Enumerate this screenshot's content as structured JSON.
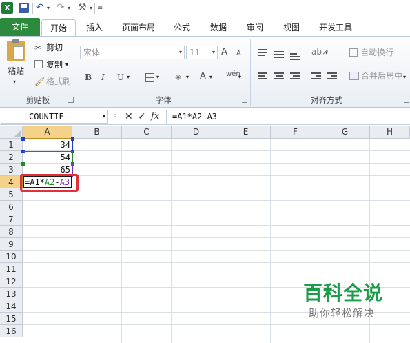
{
  "quick_access": {
    "logo": "X",
    "icons": [
      "excel-logo-icon",
      "save-icon",
      "undo-icon",
      "redo-icon",
      "tools-icon",
      "customize-icon"
    ]
  },
  "tabs": [
    {
      "label": "文件"
    },
    {
      "label": "开始"
    },
    {
      "label": "插入"
    },
    {
      "label": "页面布局"
    },
    {
      "label": "公式"
    },
    {
      "label": "数据"
    },
    {
      "label": "审阅"
    },
    {
      "label": "视图"
    },
    {
      "label": "开发工具"
    }
  ],
  "ribbon": {
    "clipboard": {
      "paste": "粘贴",
      "cut": "剪切",
      "copy": "复制",
      "format_painter": "格式刷",
      "group": "剪贴板"
    },
    "font": {
      "name": "宋体",
      "size": "11",
      "bold": "B",
      "italic": "I",
      "underline": "U",
      "grow": "A",
      "shrink": "A",
      "group": "字体"
    },
    "alignment": {
      "wrap": "自动换行",
      "merge": "合并后居中",
      "group": "对齐方式"
    },
    "accent": "#2b8a3e"
  },
  "formula_bar": {
    "name_box": "COUNTIF",
    "cancel": "✕",
    "enter": "✓",
    "fx": "fx",
    "formula": "=A1*A2-A3"
  },
  "columns": [
    "A",
    "B",
    "C",
    "D",
    "E",
    "F",
    "G",
    "H"
  ],
  "rows": [
    "1",
    "2",
    "3",
    "4",
    "5",
    "6",
    "7",
    "8",
    "9",
    "10",
    "11",
    "12",
    "13",
    "14",
    "15",
    "16"
  ],
  "cells": {
    "A1": "34",
    "A2": "54",
    "A3": "65",
    "A4_parts": [
      "=A1*",
      "A2",
      "-",
      "A3"
    ]
  },
  "range_colors": {
    "A1": "#1f3ccf",
    "A2": "#1e8a2e",
    "A3": "#7a2fb5"
  },
  "watermark": {
    "title": "百科全说",
    "subtitle": "助你轻松解决"
  }
}
